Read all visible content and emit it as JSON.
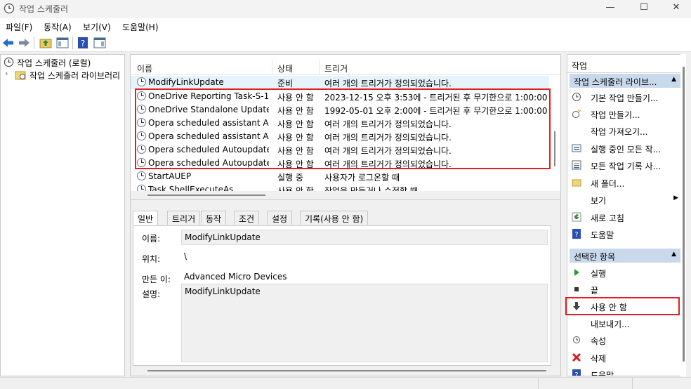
{
  "window": {
    "title": "작업 스케줄러",
    "minimize": "—",
    "maximize": "☐",
    "close": "✕"
  },
  "menu": [
    "파일(F)",
    "동작(A)",
    "보기(V)",
    "도움말(H)"
  ],
  "tree": {
    "root": "작업 스케줄러 (로컬)",
    "library": "작업 스케줄러 라이브러리"
  },
  "list": {
    "columns": {
      "name": "이름",
      "status": "상태",
      "trigger": "트리거"
    },
    "rows": [
      {
        "name": "ModifyLinkUpdate",
        "status": "준비",
        "trigger": "여러 개의 트리거가 정의되었습니다."
      },
      {
        "name": "OneDrive Reporting Task-S-1-...",
        "status": "사용 안 함",
        "trigger": "2023-12-15 오후 3:53에 - 트리거된 후 무기한으로 1:00:00"
      },
      {
        "name": "OneDrive Standalone Update T...",
        "status": "사용 안 함",
        "trigger": "1992-05-01 오후 2:00에 - 트리거된 후 무기한으로 1:00:00"
      },
      {
        "name": "Opera scheduled assistant Aut...",
        "status": "사용 안 함",
        "trigger": "여러 개의 트리거가 정의되었습니다."
      },
      {
        "name": "Opera scheduled assistant Aut...",
        "status": "사용 안 함",
        "trigger": "여러 개의 트리거가 정의되었습니다."
      },
      {
        "name": "Opera scheduled Autoupdate ...",
        "status": "사용 안 함",
        "trigger": "여러 개의 트리거가 정의되었습니다."
      },
      {
        "name": "Opera scheduled Autoupdate ...",
        "status": "사용 안 함",
        "trigger": "여러 개의 트리거가 정의되었습니다."
      },
      {
        "name": "StartAUEP",
        "status": "실행 중",
        "trigger": "사용자가 로그온할 때"
      },
      {
        "name": "Task ShellExecuteAs",
        "status": "사용 안 함",
        "trigger": "작업을 만들거나 수정할 때"
      }
    ]
  },
  "detail": {
    "tabs": [
      "일반",
      "트리거",
      "동작",
      "조건",
      "설정",
      "기록(사용 안 함)"
    ],
    "name_label": "이름:",
    "name_value": "ModifyLinkUpdate",
    "location_label": "위치:",
    "location_value": "\\",
    "author_label": "만든 이:",
    "author_value": "Advanced Micro Devices",
    "desc_label": "설명:",
    "desc_value": "ModifyLinkUpdate"
  },
  "actions": {
    "title": "작업",
    "section1": "작업 스케줄러 라이브...",
    "items1": [
      {
        "label": "기본 작업 만들기...",
        "icon": "basic-task-icon"
      },
      {
        "label": "작업 만들기...",
        "icon": "create-task-icon"
      },
      {
        "label": "작업 가져오기...",
        "icon": ""
      },
      {
        "label": "실행 중인 모든 작...",
        "icon": "running-tasks-icon"
      },
      {
        "label": "모든 작업 기록 사...",
        "icon": "history-icon"
      },
      {
        "label": "새 폴더...",
        "icon": "folder-icon"
      },
      {
        "label": "보기",
        "icon": ""
      },
      {
        "label": "새로 고침",
        "icon": "refresh-icon"
      },
      {
        "label": "도움말",
        "icon": "help-icon"
      }
    ],
    "section2": "선택한 항목",
    "items2": [
      {
        "label": "실행",
        "icon": "run-icon"
      },
      {
        "label": "끝",
        "icon": "stop-icon"
      },
      {
        "label": "사용 안 함",
        "icon": "disable-icon"
      },
      {
        "label": "내보내기...",
        "icon": ""
      },
      {
        "label": "속성",
        "icon": "properties-icon"
      },
      {
        "label": "삭제",
        "icon": "delete-icon"
      },
      {
        "label": "도움말",
        "icon": "help-icon"
      }
    ]
  },
  "colors": {
    "highlight": "#e51c23",
    "section_bg": "#c9d9ec",
    "accent_blue": "#1f6fd1"
  }
}
